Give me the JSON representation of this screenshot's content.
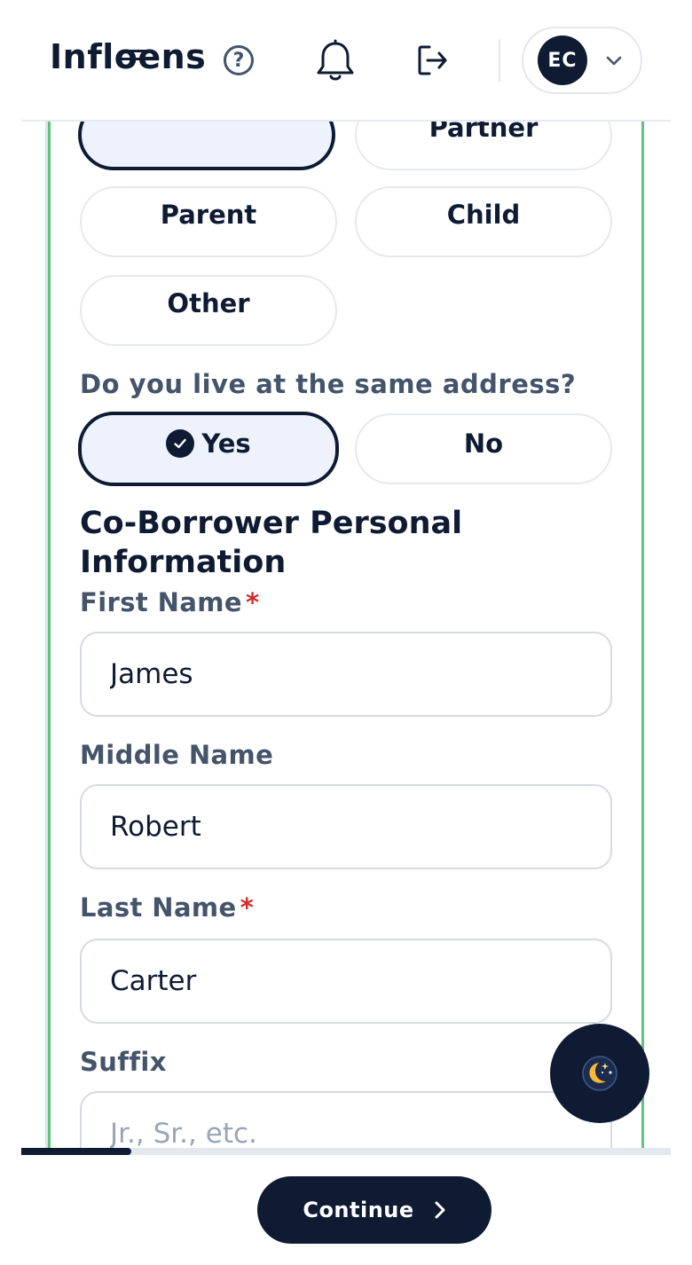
{
  "header": {
    "brand": "Infloens",
    "user_initials": "EC"
  },
  "relationship": {
    "options": [
      {
        "label": "",
        "selected": true
      },
      {
        "label": "Partner",
        "selected": false
      },
      {
        "label": "Parent",
        "selected": false
      },
      {
        "label": "Child",
        "selected": false
      },
      {
        "label": "Other",
        "selected": false
      }
    ]
  },
  "same_address": {
    "question": "Do you live at the same address?",
    "yes_label": "Yes",
    "no_label": "No",
    "selected": "Yes"
  },
  "personal_info": {
    "title": "Co-Borrower Personal Information",
    "first_name": {
      "label": "First Name",
      "required_mark": "*",
      "value": "James"
    },
    "middle_name": {
      "label": "Middle Name",
      "value": "Robert"
    },
    "last_name": {
      "label": "Last Name",
      "required_mark": "*",
      "value": "Carter"
    },
    "suffix": {
      "label": "Suffix",
      "value": "",
      "placeholder": "Jr., Sr., etc."
    }
  },
  "footer": {
    "continue_label": "Continue"
  },
  "progress": {
    "fraction": 0.17
  },
  "colors": {
    "primary": "#0f1b33",
    "selected_bg": "#edf2fd",
    "label": "#44546a",
    "required": "#d42a2a",
    "card_border": "#5fc27e"
  },
  "icons": {
    "help": "help-circle-icon",
    "notifications": "bell-icon",
    "logout": "logout-icon",
    "user_menu": "chevron-down-icon",
    "check": "check-circle-icon",
    "theme": "moon-stars-icon",
    "continue": "chevron-right-icon"
  }
}
